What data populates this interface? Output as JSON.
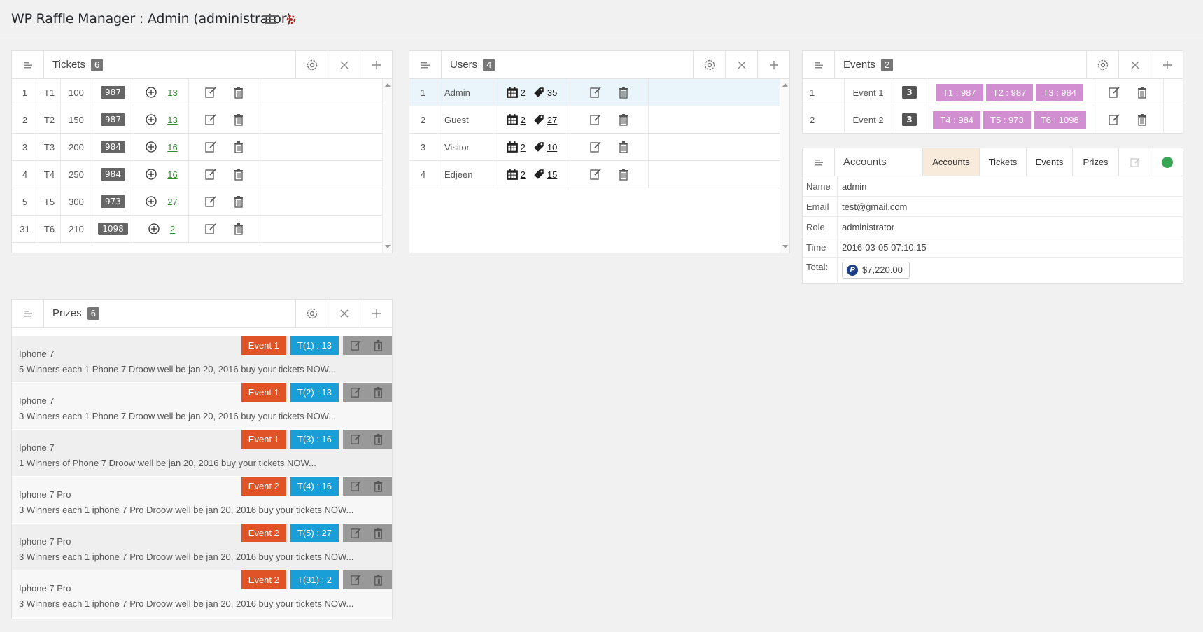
{
  "app": {
    "title": "WP Raffle Manager : Admin (administrator)",
    "menu_icon": "hamburger-icon",
    "settings_icon": "gear-icon"
  },
  "tickets": {
    "title": "Tickets",
    "count": "6",
    "rows": [
      {
        "id": "1",
        "code": "T1",
        "price": "100",
        "badge": "987",
        "link": "13"
      },
      {
        "id": "2",
        "code": "T2",
        "price": "150",
        "badge": "987",
        "link": "13"
      },
      {
        "id": "3",
        "code": "T3",
        "price": "200",
        "badge": "984",
        "link": "16"
      },
      {
        "id": "4",
        "code": "T4",
        "price": "250",
        "badge": "984",
        "link": "16"
      },
      {
        "id": "5",
        "code": "T5",
        "price": "300",
        "badge": "973",
        "link": "27"
      },
      {
        "id": "31",
        "code": "T6",
        "price": "210",
        "badge": "1098",
        "link": "2"
      }
    ]
  },
  "users": {
    "title": "Users",
    "count": "4",
    "rows": [
      {
        "id": "1",
        "name": "Admin",
        "events": "2",
        "tickets": "35"
      },
      {
        "id": "2",
        "name": "Guest",
        "events": "2",
        "tickets": "27"
      },
      {
        "id": "3",
        "name": "Visitor",
        "events": "2",
        "tickets": "10"
      },
      {
        "id": "4",
        "name": "Edjeen",
        "events": "2",
        "tickets": "15"
      }
    ]
  },
  "events": {
    "title": "Events",
    "count": "2",
    "rows": [
      {
        "id": "1",
        "name": "Event 1",
        "count": "3",
        "tags": [
          "T1 : 987",
          "T2 : 987",
          "T3 : 984"
        ]
      },
      {
        "id": "2",
        "name": "Event 2",
        "count": "3",
        "tags": [
          "T4 : 984",
          "T5 : 973",
          "T6 : 1098"
        ]
      }
    ]
  },
  "accounts": {
    "title": "Accounts",
    "tabs": [
      "Accounts",
      "Tickets",
      "Events",
      "Prizes"
    ],
    "active_tab": "Accounts",
    "status_color": "#3aa655",
    "fields": [
      {
        "key": "Name",
        "value": "admin"
      },
      {
        "key": "Email",
        "value": "test@gmail.com"
      },
      {
        "key": "Role",
        "value": "administrator"
      },
      {
        "key": "Time",
        "value": "2016-03-05 07:10:15"
      }
    ],
    "total_label": "Total:",
    "total_value": "$7,220.00",
    "total_icon": "P"
  },
  "prizes": {
    "title": "Prizes",
    "count": "6",
    "items": [
      {
        "title": "Iphone 7",
        "desc": "5 Winners each 1 Phone 7 Droow well be jan 20, 2016 buy your tickets NOW...",
        "event": "Event 1",
        "ticket": "T(1) : 13"
      },
      {
        "title": "Iphone 7",
        "desc": "3 Winners each 1 Phone 7 Droow well be jan 20, 2016 buy your tickets NOW...",
        "event": "Event 1",
        "ticket": "T(2) : 13"
      },
      {
        "title": "Iphone 7",
        "desc": "1 Winners of Phone 7 Droow well be jan 20, 2016 buy your tickets NOW...",
        "event": "Event 1",
        "ticket": "T(3) : 16"
      },
      {
        "title": "Iphone 7 Pro",
        "desc": "3 Winners each 1 iphone 7 Pro Droow well be jan 20, 2016 buy your tickets NOW...",
        "event": "Event 2",
        "ticket": "T(4) : 16"
      },
      {
        "title": "Iphone 7 Pro",
        "desc": "3 Winners each 1 iphone 7 Pro Droow well be jan 20, 2016 buy your tickets NOW...",
        "event": "Event 2",
        "ticket": "T(5) : 27"
      },
      {
        "title": "Iphone 7 Pro",
        "desc": "3 Winners each 1 iphone 7 Pro Droow well be jan 20, 2016 buy your tickets NOW...",
        "event": "Event 2",
        "ticket": "T(31) : 2"
      }
    ]
  },
  "colors": {
    "event_tag": "#e05326",
    "ticket_tag": "#1a9ed8",
    "pink_tag": "#d18fd1",
    "active_tab_bg": "#f9ebdc"
  }
}
